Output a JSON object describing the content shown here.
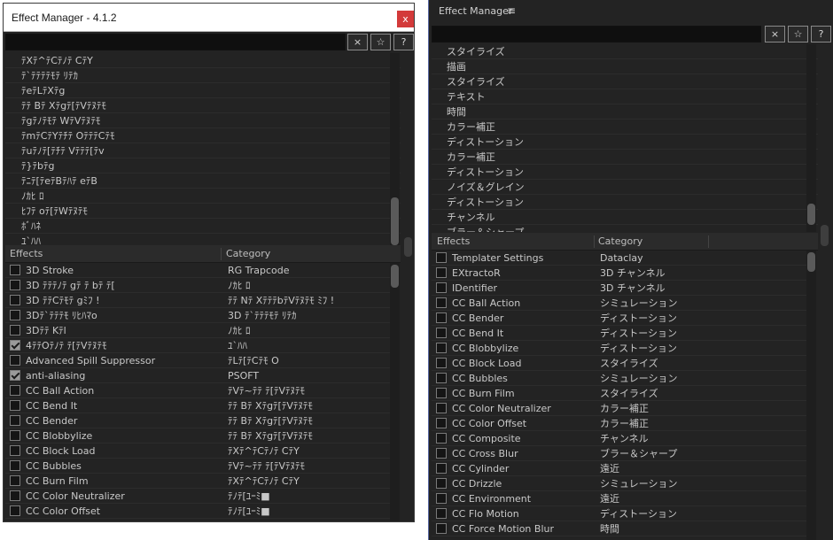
{
  "left": {
    "title": "Effect Manager - 4.1.2",
    "close_glyph": "x",
    "search": {
      "value": "",
      "placeholder": ""
    },
    "buttons": {
      "clear": "×",
      "favorite": "☆",
      "help": "?"
    },
    "category_list": [
      "ﾃXﾃ^ﾃCﾃﾉﾃ CﾃY",
      "ﾃ`ﾃﾃﾃﾃﾓﾃ ﾘﾃｶ",
      "ﾃeﾃLﾃXﾃg",
      "ﾃﾃ Bﾃ Xﾃgﾃ[ﾃVﾃﾇﾃﾓ",
      "ﾃgﾃﾉﾃﾓﾃ WﾃVﾃﾇﾃﾓ",
      "ﾃmﾃCﾃYﾃﾁﾃ OﾃﾃﾃCﾃﾓ",
      "ﾃuﾃﾉﾃ[ﾃﾁﾃ Vﾃﾃﾃ[ﾃv",
      "ﾃ}ﾃbﾃg",
      "ﾃﾆﾃ[ﾃeﾃBﾃﾊﾃ eﾃB",
      "ﾉｶﾋ ﾛ",
      "ﾋﾌﾃ oﾃ[ﾃWﾃﾇﾃﾓ",
      "ﾎﾞﾊﾈ",
      "ﾕ`ﾊﾊ"
    ],
    "table": {
      "col_effects": "Effects",
      "col_category": "Category",
      "rows": [
        {
          "checked": false,
          "effect": "3D Stroke",
          "category": "RG Trapcode"
        },
        {
          "checked": false,
          "effect": "3D ﾃﾃﾃﾉﾃ gﾃ ﾃ bﾃ ﾃ[",
          "category": "ﾉｶﾋ ﾛ"
        },
        {
          "checked": false,
          "effect": "3D ﾃﾃCﾃﾓﾃ gﾐﾌ !",
          "category": "ﾃﾃ Nﾃ XﾃﾃﾃbﾃVﾃﾇﾃﾓ ﾐﾌ !"
        },
        {
          "checked": false,
          "effect": "3Dﾃ`ﾃﾃﾃﾓ ﾘﾋﾊﾏo",
          "category": "3D ﾃ`ﾃﾃﾃﾓﾃ ﾘﾃｶ"
        },
        {
          "checked": false,
          "effect": "3Dﾃﾃ Kﾃl",
          "category": "ﾉｶﾋ ﾛ"
        },
        {
          "checked": true,
          "effect": "4ﾃﾃOﾃﾉﾃ ﾃ[ﾃVﾃﾇﾃﾓ",
          "category": "ﾕ`ﾊﾊ"
        },
        {
          "checked": false,
          "effect": "Advanced Spill Suppressor",
          "category": "ﾃLﾃ[ﾃCﾃﾓ O"
        },
        {
          "checked": true,
          "effect": "anti-aliasing",
          "category": "PSOFT"
        },
        {
          "checked": false,
          "effect": "CC Ball Action",
          "category": "ﾃVﾃ~ﾃﾃ ﾃ[ﾃVﾃﾇﾃﾓ"
        },
        {
          "checked": false,
          "effect": "CC Bend It",
          "category": "ﾃﾃ Bﾃ Xﾃgﾃ[ﾃVﾃﾇﾃﾓ"
        },
        {
          "checked": false,
          "effect": "CC Bender",
          "category": "ﾃﾃ Bﾃ Xﾃgﾃ[ﾃVﾃﾇﾃﾓ"
        },
        {
          "checked": false,
          "effect": "CC Blobbylize",
          "category": "ﾃﾃ Bﾃ Xﾃgﾃ[ﾃVﾃﾇﾃﾓ"
        },
        {
          "checked": false,
          "effect": "CC Block Load",
          "category": "ﾃXﾃ^ﾃCﾃﾉﾃ CﾃY"
        },
        {
          "checked": false,
          "effect": "CC Bubbles",
          "category": "ﾃVﾃ~ﾃﾃ ﾃ[ﾃVﾃﾇﾃﾓ"
        },
        {
          "checked": false,
          "effect": "CC Burn Film",
          "category": "ﾃXﾃ^ﾃCﾃﾉﾃ CﾃY"
        },
        {
          "checked": false,
          "effect": "CC Color Neutralizer",
          "category": "ﾃﾉﾃ[ﾕｰﾐ■"
        },
        {
          "checked": false,
          "effect": "CC Color Offset",
          "category": "ﾃﾉﾃ[ﾕｰﾐ■"
        }
      ]
    }
  },
  "right": {
    "title": "Effect Manager",
    "menu_glyph": "≡",
    "search": {
      "value": "",
      "placeholder": ""
    },
    "buttons": {
      "clear": "×",
      "favorite": "☆",
      "help": "?"
    },
    "category_list": [
      "スタイライズ",
      "描画",
      "スタイライズ",
      "テキスト",
      "時間",
      "カラー補正",
      "ディストーション",
      "カラー補正",
      "ディストーション",
      "ノイズ＆グレイン",
      "ディストーション",
      "チャンネル",
      "ブラー＆シャープ"
    ],
    "table": {
      "col_effects": "Effects",
      "col_category": "Category",
      "rows": [
        {
          "checked": false,
          "effect": "Templater Settings",
          "category": "Dataclay"
        },
        {
          "checked": false,
          "effect": "EXtractoR",
          "category": "3D チャンネル"
        },
        {
          "checked": false,
          "effect": "IDentifier",
          "category": "3D チャンネル"
        },
        {
          "checked": false,
          "effect": "CC Ball Action",
          "category": "シミュレーション"
        },
        {
          "checked": false,
          "effect": "CC Bender",
          "category": "ディストーション"
        },
        {
          "checked": false,
          "effect": "CC Bend It",
          "category": "ディストーション"
        },
        {
          "checked": false,
          "effect": "CC Blobbylize",
          "category": "ディストーション"
        },
        {
          "checked": false,
          "effect": "CC Block Load",
          "category": "スタイライズ"
        },
        {
          "checked": false,
          "effect": "CC Bubbles",
          "category": "シミュレーション"
        },
        {
          "checked": false,
          "effect": "CC Burn Film",
          "category": "スタイライズ"
        },
        {
          "checked": false,
          "effect": "CC Color Neutralizer",
          "category": "カラー補正"
        },
        {
          "checked": false,
          "effect": "CC Color Offset",
          "category": "カラー補正"
        },
        {
          "checked": false,
          "effect": "CC Composite",
          "category": "チャンネル"
        },
        {
          "checked": false,
          "effect": "CC Cross Blur",
          "category": "ブラー＆シャープ"
        },
        {
          "checked": false,
          "effect": "CC Cylinder",
          "category": "遠近"
        },
        {
          "checked": false,
          "effect": "CC Drizzle",
          "category": "シミュレーション"
        },
        {
          "checked": false,
          "effect": "CC Environment",
          "category": "遠近"
        },
        {
          "checked": false,
          "effect": "CC Flo Motion",
          "category": "ディストーション"
        },
        {
          "checked": false,
          "effect": "CC Force Motion Blur",
          "category": "時間"
        }
      ]
    }
  }
}
